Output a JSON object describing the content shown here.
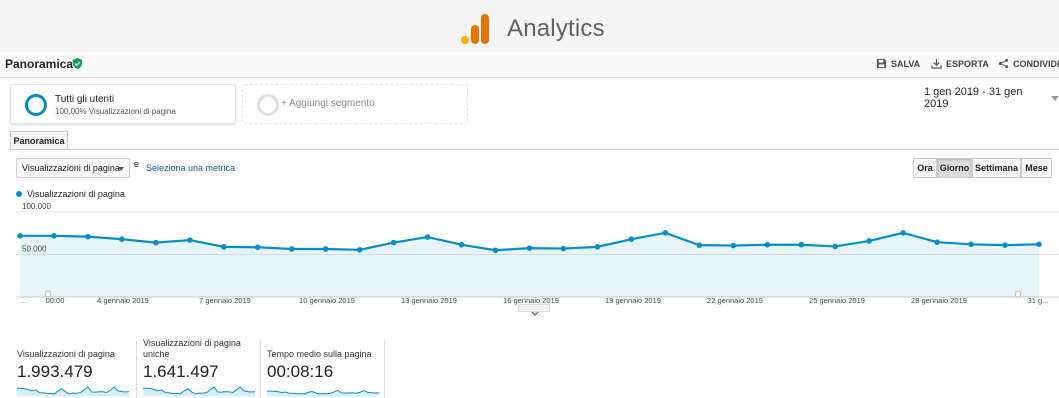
{
  "brand": {
    "name": "Analytics",
    "logo_colors": [
      "#f9ab00",
      "#e37400",
      "#e37400"
    ]
  },
  "header": {
    "title": "Panoramica",
    "verified_icon": "verified-shield-icon",
    "actions": [
      {
        "label": "SALVA",
        "icon": "save-icon"
      },
      {
        "label": "ESPORTA",
        "icon": "download-icon"
      },
      {
        "label": "CONDIVIDI",
        "icon": "share-icon"
      }
    ]
  },
  "segments": {
    "active": {
      "name": "Tutti gli utenti",
      "sub": "100,00% Visualizzazioni di pagina"
    },
    "add_label": "+ Aggiungi segmento"
  },
  "date_range": "1 gen 2019 - 31 gen 2019",
  "tab": "Panoramica",
  "metric": {
    "selected": "Visualizzazioni di pagina",
    "and_text": "e",
    "select_link": "Seleziona una metrica"
  },
  "granularity": [
    {
      "label": "Ora",
      "active": false
    },
    {
      "label": "Giorno",
      "active": true
    },
    {
      "label": "Settimana",
      "active": false
    },
    {
      "label": "Mese",
      "active": false
    }
  ],
  "accent_color": "#058dc7",
  "chart_data": {
    "type": "area",
    "series": [
      {
        "name": "Visualizzazioni di pagina",
        "values": [
          72000,
          72000,
          71000,
          68000,
          64000,
          67000,
          59000,
          58500,
          56500,
          56500,
          55500,
          64000,
          70500,
          61500,
          55000,
          57500,
          57000,
          59000,
          68000,
          75500,
          61000,
          60500,
          61500,
          61500,
          59500,
          66000,
          75500,
          64500,
          62000,
          61000,
          62000
        ]
      }
    ],
    "ylim": [
      0,
      100000
    ],
    "yticks": [
      "100.000",
      "50.000"
    ],
    "xticks": [
      "...",
      "00:00",
      "4 gennaio 2019",
      "7 gennaio 2019",
      "10 gennaio 2019",
      "13 gennaio 2019",
      "16 gennaio 2019",
      "19 gennaio 2019",
      "22 gennaio 2019",
      "25 gennaio 2019",
      "28 gennaio 2019",
      "31 g..."
    ],
    "grid": true
  },
  "scorecards": [
    {
      "label": "Visualizzazioni di pagina",
      "value": "1.993.479"
    },
    {
      "label": "Visualizzazioni di pagina uniche",
      "value": "1.641.497"
    },
    {
      "label": "Tempo medio sulla pagina",
      "value": "00:08:16"
    }
  ]
}
